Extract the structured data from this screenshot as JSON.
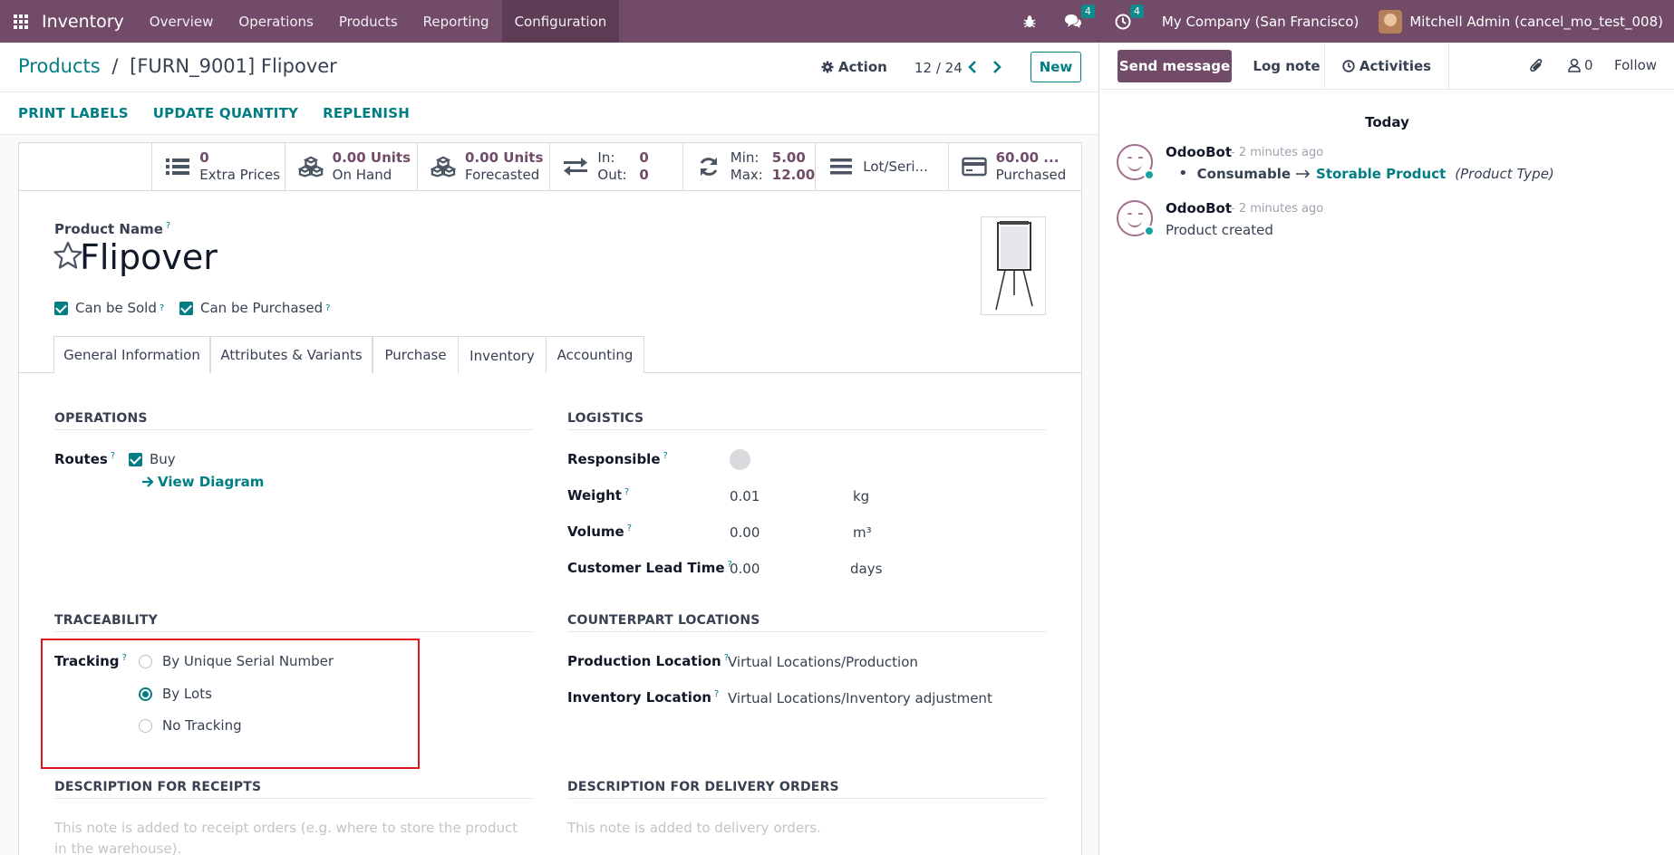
{
  "navbar": {
    "brand": "Inventory",
    "menus": [
      "Overview",
      "Operations",
      "Products",
      "Reporting",
      "Configuration"
    ],
    "messages_count": "4",
    "activities_count": "4",
    "company": "My Company (San Francisco)",
    "user": "Mitchell Admin (cancel_mo_test_008)"
  },
  "control_panel": {
    "breadcrumb_parent": "Products",
    "breadcrumb_separator": "/",
    "breadcrumb_current": "[FURN_9001] Flipover",
    "action_label": "Action",
    "pager": "12 / 24",
    "new_label": "New"
  },
  "header_buttons": [
    "PRINT LABELS",
    "UPDATE QUANTITY",
    "REPLENISH"
  ],
  "stats": {
    "extra_prices": {
      "value": "0",
      "label": "Extra Prices"
    },
    "on_hand": {
      "value": "0.00 Units",
      "label": "On Hand"
    },
    "forecasted": {
      "value": "0.00 Units",
      "label": "Forecasted"
    },
    "in_out": {
      "in_label": "In:",
      "in_value": "0",
      "out_label": "Out:",
      "out_value": "0"
    },
    "min_max": {
      "min_label": "Min:",
      "min_value": "5.00",
      "max_label": "Max:",
      "max_value": "12.00"
    },
    "lot_serial": {
      "label": "Lot/Seri..."
    },
    "purchased": {
      "value": "60.00 ...",
      "label": "Purchased"
    }
  },
  "product": {
    "name_label": "Product Name",
    "name": "Flipover",
    "can_be_sold": "Can be Sold",
    "can_be_purchased": "Can be Purchased"
  },
  "tabs": [
    "General Information",
    "Attributes & Variants",
    "Purchase",
    "Inventory",
    "Accounting"
  ],
  "operations": {
    "title": "OPERATIONS",
    "routes_label": "Routes",
    "route_buy": "Buy",
    "view_diagram": "View Diagram"
  },
  "logistics": {
    "title": "LOGISTICS",
    "responsible_label": "Responsible",
    "weight_label": "Weight",
    "weight_value": "0.01",
    "weight_unit": "kg",
    "volume_label": "Volume",
    "volume_value": "0.00",
    "volume_unit": "m³",
    "lead_time_label": "Customer Lead Time",
    "lead_time_value": "0.00",
    "lead_time_unit": "days"
  },
  "traceability": {
    "title": "TRACEABILITY",
    "tracking_label": "Tracking",
    "options": [
      "By Unique Serial Number",
      "By Lots",
      "No Tracking"
    ],
    "selected": "By Lots"
  },
  "counterpart": {
    "title": "COUNTERPART LOCATIONS",
    "production_label": "Production Location",
    "production_value": "Virtual Locations/Production",
    "inventory_label": "Inventory Location",
    "inventory_value": "Virtual Locations/Inventory adjustment"
  },
  "descriptions": {
    "receipts_title": "DESCRIPTION FOR RECEIPTS",
    "receipts_placeholder": "This note is added to receipt orders (e.g. where to store the product in the warehouse).",
    "delivery_title": "DESCRIPTION FOR DELIVERY ORDERS",
    "delivery_placeholder": "This note is added to delivery orders."
  },
  "chatter": {
    "send_message": "Send message",
    "log_note": "Log note",
    "activities": "Activities",
    "followers_count": "0",
    "follow": "Follow",
    "today": "Today",
    "messages": [
      {
        "author": "OdooBot",
        "time": "- 2 minutes ago",
        "old": "Consumable",
        "new": "Storable Product",
        "field": "(Product Type)"
      },
      {
        "author": "OdooBot",
        "time": "- 2 minutes ago",
        "body": "Product created"
      }
    ]
  },
  "colors": {
    "navbar": "#714b67",
    "accent": "#017e84",
    "highlight": "#e0141e"
  }
}
